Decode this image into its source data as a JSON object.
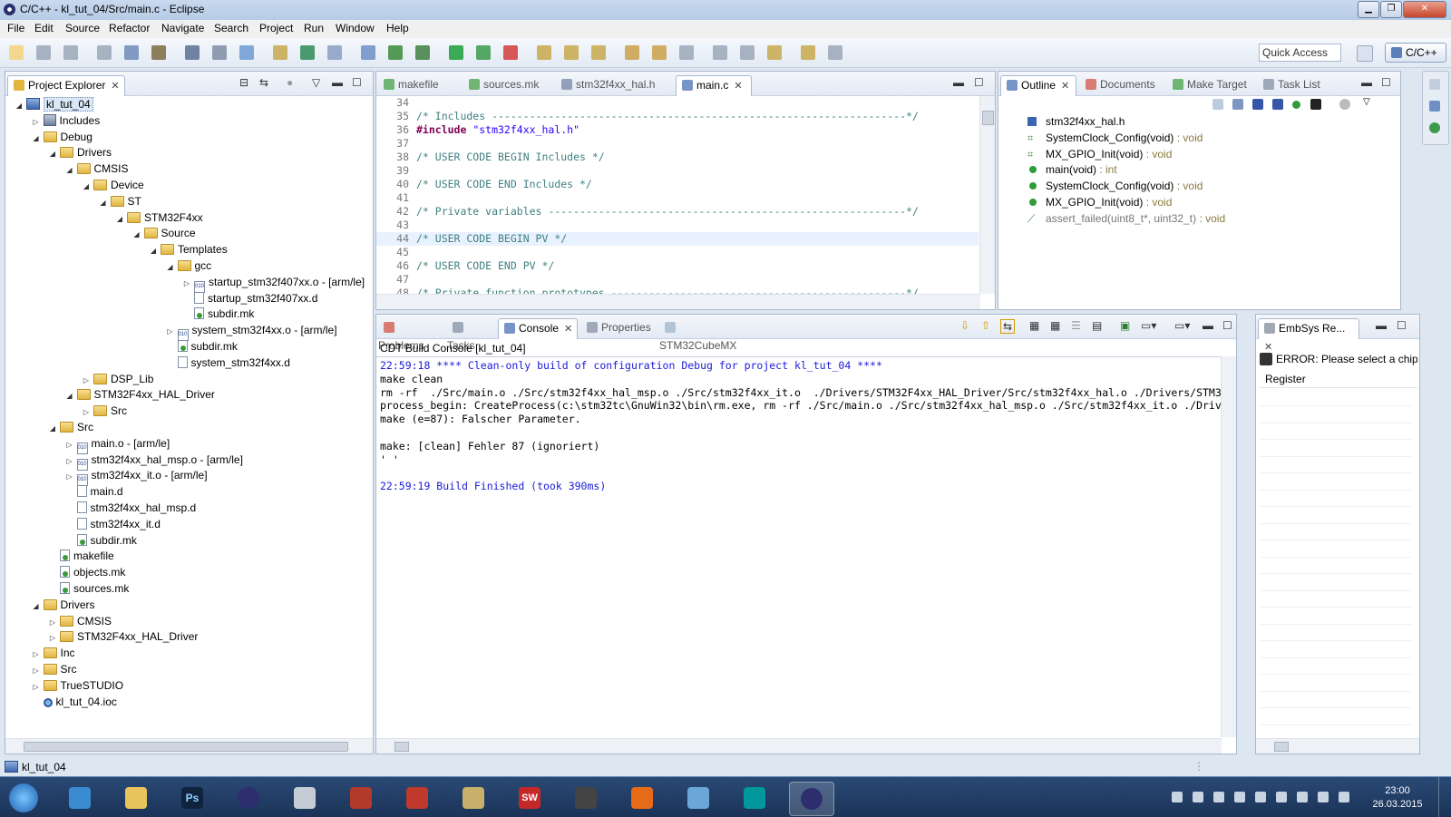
{
  "window": {
    "title": "C/C++ - kl_tut_04/Src/main.c - Eclipse"
  },
  "menu": [
    "File",
    "Edit",
    "Source",
    "Refactor",
    "Navigate",
    "Search",
    "Project",
    "Run",
    "Window",
    "Help"
  ],
  "toolbar": {
    "quick_access": "Quick Access",
    "perspective": "C/C++"
  },
  "project_explorer": {
    "tab": "Project Explorer",
    "tree": [
      {
        "label": "kl_tut_04",
        "depth": 0,
        "icon": "project-icon",
        "twisty": "open",
        "selected": true
      },
      {
        "label": "Includes",
        "depth": 1,
        "icon": "includes-icon",
        "twisty": "closed"
      },
      {
        "label": "Debug",
        "depth": 1,
        "icon": "folder-icon",
        "twisty": "open"
      },
      {
        "label": "Drivers",
        "depth": 2,
        "icon": "folder-icon",
        "twisty": "open"
      },
      {
        "label": "CMSIS",
        "depth": 3,
        "icon": "folder-icon",
        "twisty": "open"
      },
      {
        "label": "Device",
        "depth": 4,
        "icon": "folder-icon",
        "twisty": "open"
      },
      {
        "label": "ST",
        "depth": 5,
        "icon": "folder-icon",
        "twisty": "open"
      },
      {
        "label": "STM32F4xx",
        "depth": 6,
        "icon": "folder-icon",
        "twisty": "open"
      },
      {
        "label": "Source",
        "depth": 7,
        "icon": "folder-icon",
        "twisty": "open"
      },
      {
        "label": "Templates",
        "depth": 8,
        "icon": "folder-icon",
        "twisty": "open"
      },
      {
        "label": "gcc",
        "depth": 9,
        "icon": "folder-icon",
        "twisty": "open"
      },
      {
        "label": "startup_stm32f407xx.o - [arm/le]",
        "depth": 10,
        "icon": "object-file-icon",
        "twisty": "closed"
      },
      {
        "label": "startup_stm32f407xx.d",
        "depth": 10,
        "icon": "file-icon",
        "twisty": "none"
      },
      {
        "label": "subdir.mk",
        "depth": 10,
        "icon": "makefile-icon",
        "twisty": "none"
      },
      {
        "label": "system_stm32f4xx.o - [arm/le]",
        "depth": 9,
        "icon": "object-file-icon",
        "twisty": "closed"
      },
      {
        "label": "subdir.mk",
        "depth": 9,
        "icon": "makefile-icon",
        "twisty": "none"
      },
      {
        "label": "system_stm32f4xx.d",
        "depth": 9,
        "icon": "file-icon",
        "twisty": "none"
      },
      {
        "label": "DSP_Lib",
        "depth": 4,
        "icon": "folder-icon",
        "twisty": "closed"
      },
      {
        "label": "STM32F4xx_HAL_Driver",
        "depth": 3,
        "icon": "folder-icon",
        "twisty": "open"
      },
      {
        "label": "Src",
        "depth": 4,
        "icon": "folder-icon",
        "twisty": "closed"
      },
      {
        "label": "Src",
        "depth": 2,
        "icon": "folder-icon",
        "twisty": "open"
      },
      {
        "label": "main.o - [arm/le]",
        "depth": 3,
        "icon": "object-file-icon",
        "twisty": "closed"
      },
      {
        "label": "stm32f4xx_hal_msp.o - [arm/le]",
        "depth": 3,
        "icon": "object-file-icon",
        "twisty": "closed"
      },
      {
        "label": "stm32f4xx_it.o - [arm/le]",
        "depth": 3,
        "icon": "object-file-icon",
        "twisty": "closed"
      },
      {
        "label": "main.d",
        "depth": 3,
        "icon": "file-icon",
        "twisty": "none"
      },
      {
        "label": "stm32f4xx_hal_msp.d",
        "depth": 3,
        "icon": "file-icon",
        "twisty": "none"
      },
      {
        "label": "stm32f4xx_it.d",
        "depth": 3,
        "icon": "file-icon",
        "twisty": "none"
      },
      {
        "label": "subdir.mk",
        "depth": 3,
        "icon": "makefile-icon",
        "twisty": "none"
      },
      {
        "label": "makefile",
        "depth": 2,
        "icon": "makefile-icon",
        "twisty": "none"
      },
      {
        "label": "objects.mk",
        "depth": 2,
        "icon": "makefile-icon",
        "twisty": "none"
      },
      {
        "label": "sources.mk",
        "depth": 2,
        "icon": "makefile-icon",
        "twisty": "none"
      },
      {
        "label": "Drivers",
        "depth": 1,
        "icon": "folder-icon",
        "twisty": "open"
      },
      {
        "label": "CMSIS",
        "depth": 2,
        "icon": "folder-icon",
        "twisty": "closed"
      },
      {
        "label": "STM32F4xx_HAL_Driver",
        "depth": 2,
        "icon": "folder-icon",
        "twisty": "closed"
      },
      {
        "label": "Inc",
        "depth": 1,
        "icon": "folder-icon",
        "twisty": "closed"
      },
      {
        "label": "Src",
        "depth": 1,
        "icon": "folder-icon",
        "twisty": "closed"
      },
      {
        "label": "TrueSTUDIO",
        "depth": 1,
        "icon": "folder-icon",
        "twisty": "closed"
      },
      {
        "label": "kl_tut_04.ioc",
        "depth": 1,
        "icon": "ioc-file-icon",
        "twisty": "none"
      }
    ]
  },
  "editor": {
    "tabs": [
      {
        "label": "makefile",
        "active": false,
        "icon": "makefile-icon"
      },
      {
        "label": "sources.mk",
        "active": false,
        "icon": "makefile-icon"
      },
      {
        "label": "stm32f4xx_hal.h",
        "active": false,
        "icon": "header-file-icon"
      },
      {
        "label": "main.c",
        "active": true,
        "icon": "c-file-icon"
      }
    ],
    "lines": [
      {
        "n": "34",
        "parts": []
      },
      {
        "n": "35",
        "parts": [
          {
            "t": "/* Includes ------------------------------------------------------------------*/",
            "c": "cmt"
          }
        ]
      },
      {
        "n": "36",
        "parts": [
          {
            "t": "#include ",
            "c": "pp"
          },
          {
            "t": "\"stm32f4xx_hal.h\"",
            "c": "str"
          }
        ]
      },
      {
        "n": "37",
        "parts": []
      },
      {
        "n": "38",
        "parts": [
          {
            "t": "/* USER CODE BEGIN Includes */",
            "c": "cmt"
          }
        ]
      },
      {
        "n": "39",
        "parts": []
      },
      {
        "n": "40",
        "parts": [
          {
            "t": "/* USER CODE END Includes */",
            "c": "cmt"
          }
        ]
      },
      {
        "n": "41",
        "parts": []
      },
      {
        "n": "42",
        "parts": [
          {
            "t": "/* Private variables ---------------------------------------------------------*/",
            "c": "cmt"
          }
        ]
      },
      {
        "n": "43",
        "parts": []
      },
      {
        "n": "44",
        "parts": [
          {
            "t": "/* USER CODE BEGIN PV */",
            "c": "cmt"
          }
        ],
        "highlight": true
      },
      {
        "n": "45",
        "parts": []
      },
      {
        "n": "46",
        "parts": [
          {
            "t": "/* USER CODE END PV */",
            "c": "cmt"
          }
        ]
      },
      {
        "n": "47",
        "parts": []
      },
      {
        "n": "48",
        "parts": [
          {
            "t": "/* Private function prototypes -----------------------------------------------*/",
            "c": "cmt"
          }
        ]
      }
    ]
  },
  "outline": {
    "tabs": [
      {
        "label": "Outline",
        "active": true,
        "icon": "outline-icon"
      },
      {
        "label": "Documents",
        "active": false,
        "icon": "documents-icon"
      },
      {
        "label": "Make Target",
        "active": false,
        "icon": "make-target-icon"
      },
      {
        "label": "Task List",
        "active": false,
        "icon": "task-list-icon"
      }
    ],
    "items": [
      {
        "name": "stm32f4xx_hal.h",
        "type": "",
        "icon": "include-icon"
      },
      {
        "name": "SystemClock_Config(void)",
        "type": " : void",
        "icon": "declaration-icon"
      },
      {
        "name": "MX_GPIO_Init(void)",
        "type": " : void",
        "icon": "static-declaration-icon"
      },
      {
        "name": "main(void)",
        "type": " : int",
        "icon": "function-icon"
      },
      {
        "name": "SystemClock_Config(void)",
        "type": " : void",
        "icon": "function-icon"
      },
      {
        "name": "MX_GPIO_Init(void)",
        "type": " : void",
        "icon": "function-icon"
      },
      {
        "name": "assert_failed(uint8_t*, uint32_t)",
        "type": " : void",
        "icon": "inactive-function-icon",
        "dim": true
      }
    ]
  },
  "bottom": {
    "tabs": [
      {
        "label": "Problems",
        "active": false,
        "icon": "problems-icon"
      },
      {
        "label": "Tasks",
        "active": false,
        "icon": "tasks-icon"
      },
      {
        "label": "Console",
        "active": true,
        "icon": "console-icon"
      },
      {
        "label": "Properties",
        "active": false,
        "icon": "properties-icon"
      },
      {
        "label": "STM32CubeMX",
        "active": false,
        "icon": "cubemx-icon"
      }
    ],
    "console_title": "CDT Build Console [kl_tut_04]",
    "console_lines": [
      {
        "t": "22:59:18 **** Clean-only build of configuration Debug for project kl_tut_04 ****",
        "c": "blue"
      },
      {
        "t": "make clean",
        "c": ""
      },
      {
        "t": "rm -rf  ./Src/main.o ./Src/stm32f4xx_hal_msp.o ./Src/stm32f4xx_it.o  ./Drivers/STM32F4xx_HAL_Driver/Src/stm32f4xx_hal.o ./Drivers/STM32",
        "c": ""
      },
      {
        "t": "process_begin: CreateProcess(c:\\stm32tc\\GnuWin32\\bin\\rm.exe, rm -rf ./Src/main.o ./Src/stm32f4xx_hal_msp.o ./Src/stm32f4xx_it.o ./Drive",
        "c": ""
      },
      {
        "t": "make (e=87): Falscher Parameter.",
        "c": ""
      },
      {
        "t": "",
        "c": ""
      },
      {
        "t": "make: [clean] Fehler 87 (ignoriert)",
        "c": ""
      },
      {
        "t": "' '",
        "c": ""
      },
      {
        "t": "",
        "c": ""
      },
      {
        "t": "22:59:19 Build Finished (took 390ms)",
        "c": "blue"
      }
    ]
  },
  "embsys": {
    "tab": "EmbSys Re...",
    "error": "ERROR: Please select a chip u",
    "column_header": "Register"
  },
  "status": {
    "selected": "kl_tut_04"
  },
  "taskbar": {
    "apps": [
      "start-button",
      "internet-explorer-icon",
      "file-explorer-icon",
      "photoshop-icon",
      "eclipse-icon",
      "calculator-icon",
      "bug-icon",
      "pdf-icon",
      "archive-icon",
      "solidworks-icon",
      "spring-icon",
      "firefox-icon",
      "remote-desktop-icon",
      "arduino-icon",
      "eclipse-active-icon"
    ],
    "photoshop_label": "Ps",
    "solidworks_label": "SW",
    "time": "23:00",
    "date": "26.03.2015"
  }
}
